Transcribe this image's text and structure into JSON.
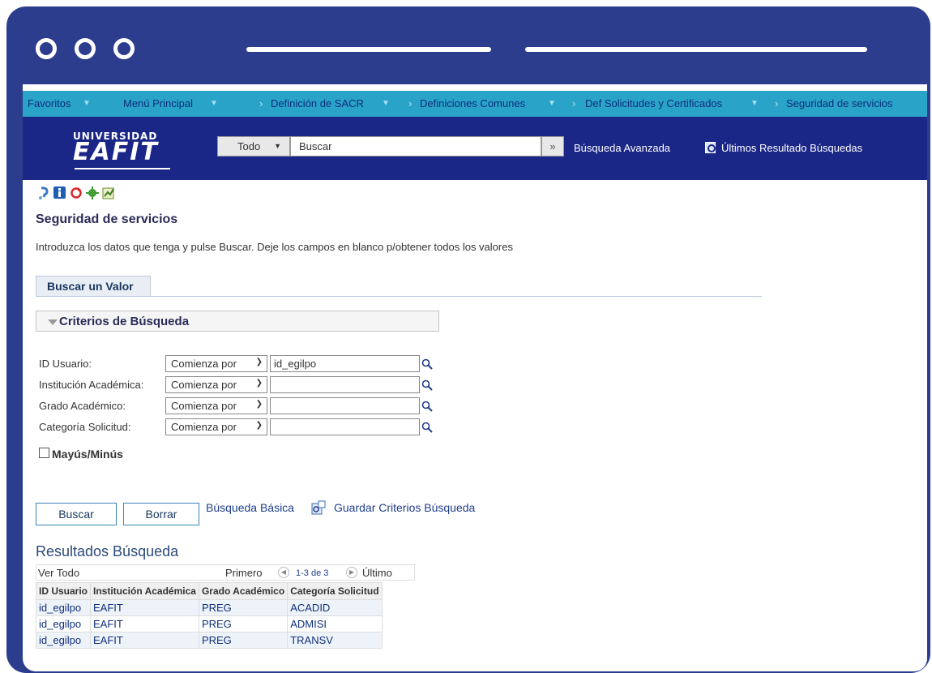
{
  "nav": {
    "favorites": "Favoritos",
    "main_menu": "Menú Principal",
    "crumbs": [
      "Definición de SACR",
      "Definiciones Comunes",
      "Def Solicitudes y Certificados",
      "Seguridad de servicios"
    ]
  },
  "header": {
    "logo_top": "UNIVERSIDAD",
    "logo_main": "EAFIT",
    "search_scope": "Todo",
    "search_placeholder": "Buscar",
    "advanced_search": "Búsqueda Avanzada",
    "last_results": "Últimos Resultado Búsquedas"
  },
  "page": {
    "title": "Seguridad de servicios",
    "instructions": "Introduzca los datos que tenga y pulse Buscar. Deje los campos en blanco p/obtener todos los valores",
    "tab": "Buscar un Valor",
    "criteria_title": "Criterios de Búsqueda"
  },
  "fields": [
    {
      "label": "ID Usuario:",
      "operator": "Comienza por",
      "value": "id_egilpo"
    },
    {
      "label": "Institución Académica:",
      "operator": "Comienza por",
      "value": ""
    },
    {
      "label": "Grado Académico:",
      "operator": "Comienza por",
      "value": ""
    },
    {
      "label": "Categoría Solicitud:",
      "operator": "Comienza por",
      "value": ""
    }
  ],
  "case_checkbox": {
    "label": "Mayús/Minús",
    "checked": false
  },
  "buttons": {
    "search": "Buscar",
    "clear": "Borrar",
    "basic_search": "Búsqueda Básica",
    "save_criteria": "Guardar Criterios Búsqueda"
  },
  "results": {
    "title": "Resultados Búsqueda",
    "view_all": "Ver Todo",
    "first": "Primero",
    "range": "1-3 de 3",
    "last": "Último",
    "columns": [
      "ID Usuario",
      "Institución Académica",
      "Grado Académico",
      "Categoría Solicitud"
    ],
    "rows": [
      [
        "id_egilpo",
        "EAFIT",
        "PREG",
        "ACADID"
      ],
      [
        "id_egilpo",
        "EAFIT",
        "PREG",
        "ADMISI"
      ],
      [
        "id_egilpo",
        "EAFIT",
        "PREG",
        "TRANSV"
      ]
    ]
  },
  "colors": {
    "frame": "#2d3d8e",
    "nav": "#2aa3c8",
    "header": "#1b2787"
  }
}
